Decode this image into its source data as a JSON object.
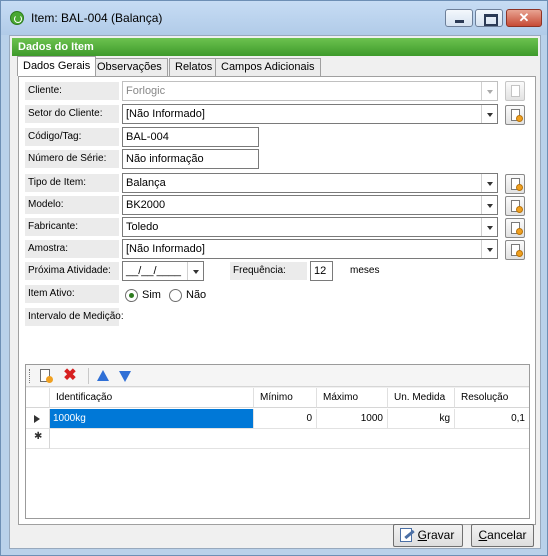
{
  "window": {
    "title": "Item: BAL-004 (Balança)"
  },
  "header": {
    "title": "Dados do Item"
  },
  "tabs": [
    "Dados Gerais",
    "Observações",
    "Relatos",
    "Campos Adicionais"
  ],
  "form": {
    "cliente": {
      "label": "Cliente:",
      "value": "Forlogic"
    },
    "setor": {
      "label": "Setor do Cliente:",
      "value": "[Não Informado]"
    },
    "codigo": {
      "label": "Código/Tag:",
      "value": "BAL-004"
    },
    "numero_serie": {
      "label": "Número de Série:",
      "value": "Não informação"
    },
    "tipo_item": {
      "label": "Tipo de Item:",
      "value": "Balança"
    },
    "modelo": {
      "label": "Modelo:",
      "value": "BK2000"
    },
    "fabricante": {
      "label": "Fabricante:",
      "value": "Toledo"
    },
    "amostra": {
      "label": "Amostra:",
      "value": "[Não Informado]"
    },
    "proxima_atividade": {
      "label": "Próxima Atividade:",
      "value": "__/__/____"
    },
    "frequencia": {
      "label": "Frequência:",
      "value": "12",
      "unit": "meses"
    },
    "item_ativo": {
      "label": "Item Ativo:",
      "options": [
        "Sim",
        "Não"
      ],
      "selected": "Sim"
    },
    "intervalo": {
      "label": "Intervalo de Medição:"
    }
  },
  "grid": {
    "columns": [
      "Identificação",
      "Mínimo",
      "Máximo",
      "Un. Medida",
      "Resolução"
    ],
    "rows": [
      {
        "identificacao": "1000kg",
        "minimo": "0",
        "maximo": "1000",
        "unidade": "kg",
        "resolucao": "0,1"
      }
    ]
  },
  "buttons": {
    "save": {
      "mnemonic": "G",
      "rest": "ravar"
    },
    "cancel": {
      "mnemonic": "C",
      "rest": "ancelar"
    }
  },
  "colors": {
    "header_green": "#4caf36",
    "selection_blue": "#0078d7",
    "frame_blue": "#b9d1ea"
  }
}
